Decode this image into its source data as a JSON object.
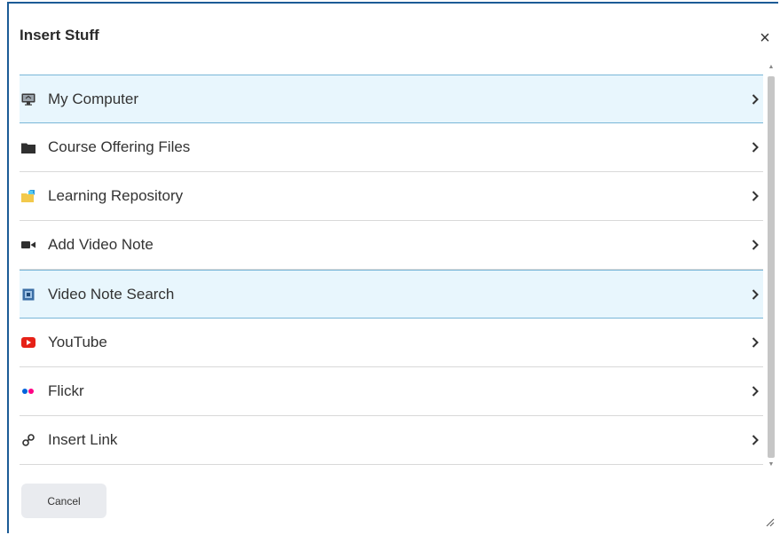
{
  "dialog": {
    "title": "Insert Stuff",
    "close_glyph": "×"
  },
  "items": [
    {
      "label": "My Computer",
      "icon": "monitor-icon",
      "selected": true
    },
    {
      "label": "Course Offering Files",
      "icon": "folder-icon",
      "selected": false
    },
    {
      "label": "Learning Repository",
      "icon": "repository-icon",
      "selected": false
    },
    {
      "label": "Add Video Note",
      "icon": "video-camera-icon",
      "selected": false
    },
    {
      "label": "Video Note Search",
      "icon": "video-search-icon",
      "selected": true
    },
    {
      "label": "YouTube",
      "icon": "youtube-icon",
      "selected": false
    },
    {
      "label": "Flickr",
      "icon": "flickr-icon",
      "selected": false
    },
    {
      "label": "Insert Link",
      "icon": "link-icon",
      "selected": false
    }
  ],
  "footer": {
    "cancel_label": "Cancel"
  },
  "colors": {
    "accent_border": "#1c5b96",
    "selected_bg": "#e8f6fd",
    "youtube_red": "#e62117",
    "flickr_blue": "#0063dc",
    "flickr_pink": "#ff0084"
  }
}
